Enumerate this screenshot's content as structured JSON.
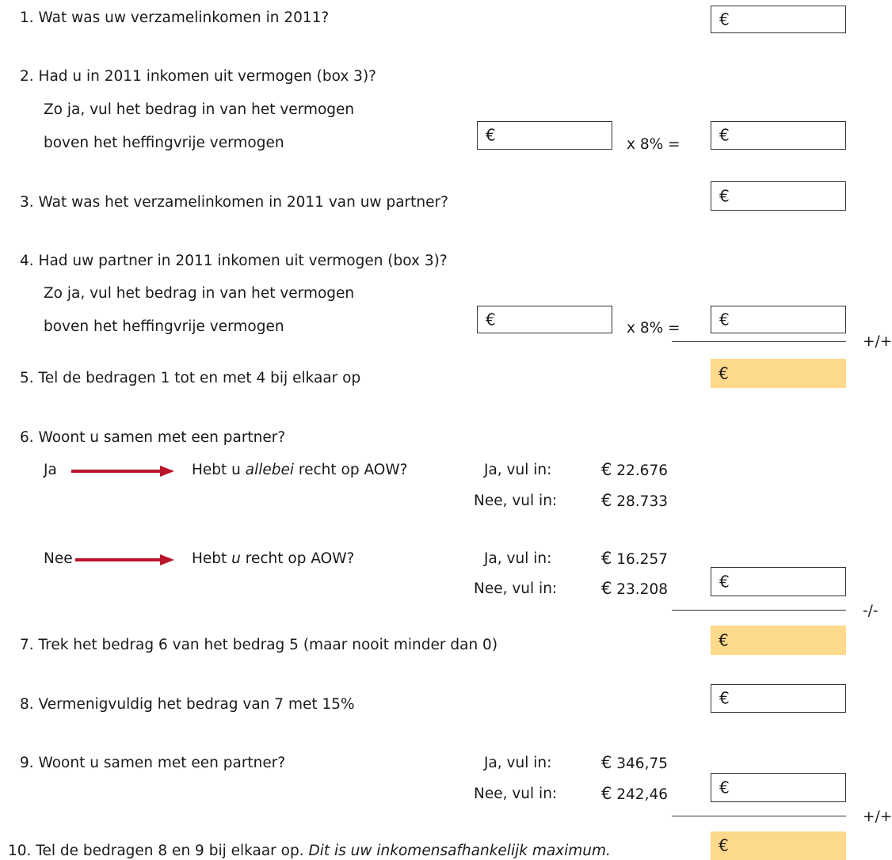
{
  "q1": {
    "text": "1. Wat was uw verzamelinkomen in 2011?"
  },
  "q2": {
    "line1": "2. Had u in 2011 inkomen uit vermogen (box 3)?",
    "line2": "Zo ja, vul het bedrag in van het vermogen",
    "line3": "boven het heffingvrije vermogen",
    "multiplier": "x 8% ="
  },
  "q3": {
    "text": "3. Wat was het verzamelinkomen in 2011 van uw partner?"
  },
  "q4": {
    "line1": "4. Had uw partner in 2011 inkomen uit vermogen (box 3)?",
    "line2": "Zo ja, vul het bedrag in van het vermogen",
    "line3": "boven het heffingvrije vermogen",
    "multiplier": "x 8% ="
  },
  "op_plus": "+/+",
  "op_minus": "-/-",
  "q5": {
    "text": "5. Tel de bedragen 1 tot en met 4 bij elkaar op"
  },
  "q6": {
    "text": "6. Woont u samen met een partner?",
    "ja": {
      "label": "Ja",
      "question_before": "Hebt u ",
      "question_em": "allebei",
      "question_after": " recht op AOW?",
      "yes_label": "Ja, vul in:",
      "yes_amount": "22.676",
      "no_label": "Nee, vul in:",
      "no_amount": "28.733"
    },
    "nee": {
      "label": "Nee",
      "question_before": "Hebt ",
      "question_em": "u",
      "question_after": " recht op AOW?",
      "yes_label": "Ja, vul in:",
      "yes_amount": "16.257",
      "no_label": "Nee, vul in:",
      "no_amount": "23.208"
    }
  },
  "q7": {
    "text": "7. Trek het bedrag 6 van het bedrag 5 (maar nooit minder dan 0)"
  },
  "q8": {
    "text": "8. Vermenigvuldig het bedrag van 7 met 15%"
  },
  "q9": {
    "text": "9. Woont u samen met een partner?",
    "yes_label": "Ja, vul in:",
    "yes_amount": "346,75",
    "no_label": "Nee, vul in:",
    "no_amount": "242,46"
  },
  "q10": {
    "text": "10. Tel de bedragen 8 en 9 bij elkaar op. ",
    "em": "Dit is uw inkomensafhankelijk maximum."
  },
  "currency": "€",
  "colors": {
    "sum_fill": "#fdd98b",
    "arrow": "#b8142a"
  }
}
